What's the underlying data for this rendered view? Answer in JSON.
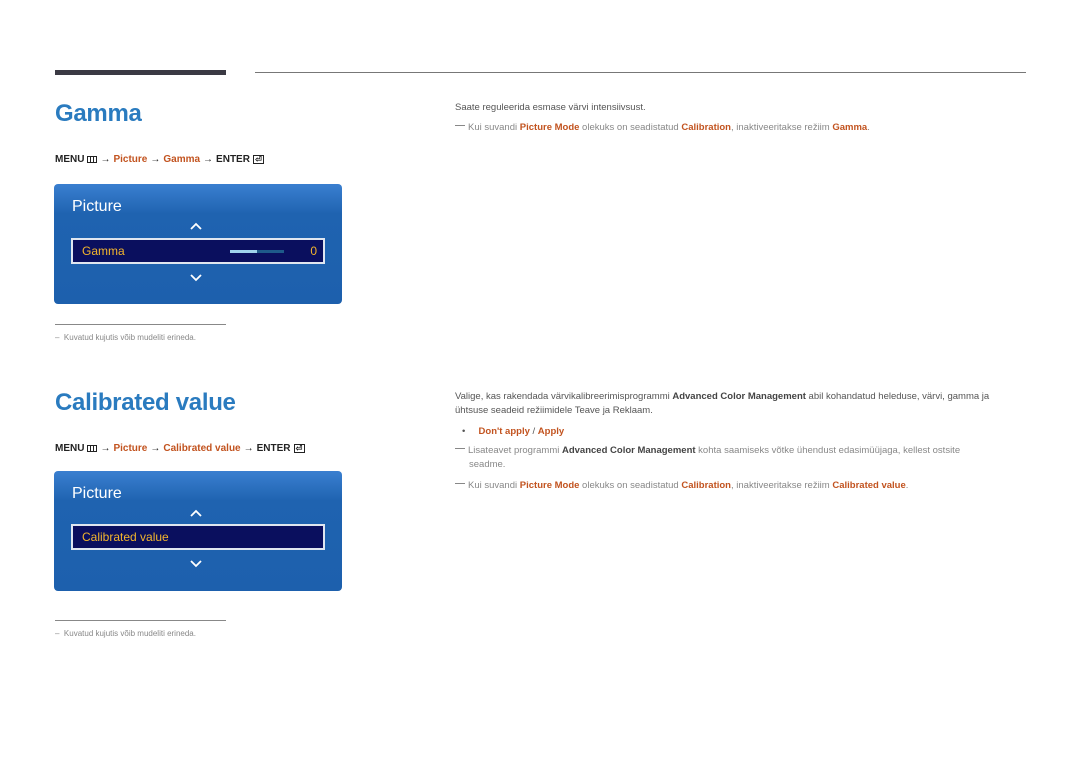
{
  "section1": {
    "title": "Gamma",
    "menu_path": {
      "menu": "MENU",
      "arrow": "→",
      "step1": "Picture",
      "step2": "Gamma",
      "enter": "ENTER",
      "enter_icon": "⏎"
    },
    "osd": {
      "title": "Picture",
      "item_label": "Gamma",
      "value": "0",
      "slider_fill_percent": 50
    },
    "footnote": "Kuvatud kujutis võib mudeliti erineda.",
    "footnote_mark": "–",
    "description": "Saate reguleerida esmase värvi intensiivsust.",
    "note": {
      "p1": "Kui suvandi ",
      "k1": "Picture Mode",
      "p2": " olekuks on seadistatud ",
      "k2": "Calibration",
      "p3": ", inaktiveeritakse režiim ",
      "k3": "Gamma",
      "p4": "."
    }
  },
  "section2": {
    "title": "Calibrated value",
    "menu_path": {
      "menu": "MENU",
      "arrow": "→",
      "step1": "Picture",
      "step2": "Calibrated value",
      "enter": "ENTER",
      "enter_icon": "⏎"
    },
    "osd": {
      "title": "Picture",
      "item_label": "Calibrated value"
    },
    "footnote": "Kuvatud kujutis võib mudeliti erineda.",
    "footnote_mark": "–",
    "description": {
      "p1": "Valige, kas rakendada värvikalibreerimisprogrammi ",
      "k1": "Advanced Color Management",
      "p2": " abil kohandatud heleduse, värvi, gamma ja",
      "line2": "ühtsuse seadeid režiimidele Teave ja Reklaam."
    },
    "options": {
      "bullet": "•",
      "opt1": "Don't apply",
      "sep": " / ",
      "opt2": "Apply"
    },
    "note1": {
      "p1": "Lisateavet programmi ",
      "k1": "Advanced Color Management",
      "p2": " kohta saamiseks võtke ühendust edasimüüjaga, kellest ostsite",
      "line2": "seadme."
    },
    "note2": {
      "p1": "Kui suvandi ",
      "k1": "Picture Mode",
      "p2": " olekuks on seadistatud ",
      "k2": "Calibration",
      "p3": ", inaktiveeritakse režiim ",
      "k3": "Calibrated value",
      "p4": "."
    }
  }
}
